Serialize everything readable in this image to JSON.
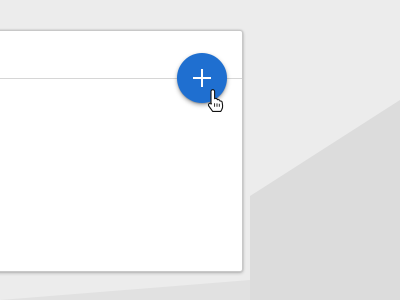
{
  "fab": {
    "icon": "plus-icon",
    "color": "#1f6fd0"
  },
  "cursor": {
    "icon": "hand-pointer-icon"
  }
}
